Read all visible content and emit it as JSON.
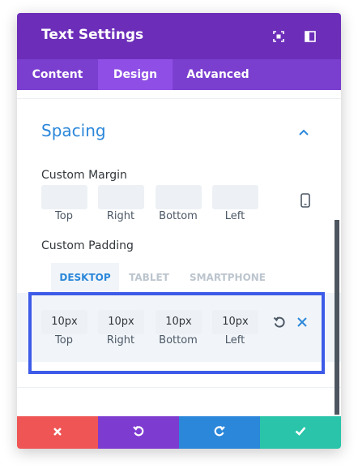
{
  "header": {
    "title": "Text Settings",
    "expand_icon": "expand-icon",
    "sidebar_icon": "split-panel-icon",
    "color": "#6c2eb9"
  },
  "tabs": [
    {
      "label": "Content",
      "active": false
    },
    {
      "label": "Design",
      "active": true
    },
    {
      "label": "Advanced",
      "active": false
    }
  ],
  "spacing": {
    "title": "Spacing",
    "margin": {
      "label": "Custom Margin",
      "fields": [
        {
          "label": "Top",
          "value": ""
        },
        {
          "label": "Right",
          "value": ""
        },
        {
          "label": "Bottom",
          "value": ""
        },
        {
          "label": "Left",
          "value": ""
        }
      ],
      "responsive_icon": "phone-icon"
    },
    "padding": {
      "label": "Custom Padding",
      "device_tabs": [
        {
          "label": "DESKTOP",
          "active": true
        },
        {
          "label": "TABLET",
          "active": false
        },
        {
          "label": "SMARTPHONE",
          "active": false
        }
      ],
      "fields": [
        {
          "label": "Top",
          "value": "10px"
        },
        {
          "label": "Right",
          "value": "10px"
        },
        {
          "label": "Bottom",
          "value": "10px"
        },
        {
          "label": "Left",
          "value": "10px"
        }
      ],
      "reset_icon": "reset-icon",
      "clear_icon": "close-icon"
    }
  },
  "footer": [
    {
      "icon": "close-icon",
      "color": "#ef5555"
    },
    {
      "icon": "undo-icon",
      "color": "#7e3bd0"
    },
    {
      "icon": "redo-icon",
      "color": "#2b87da"
    },
    {
      "icon": "check-icon",
      "color": "#29c4a9"
    }
  ],
  "colors": {
    "accent": "#2b87da",
    "highlight": "#3d5be8",
    "tab_bar": "#7b3fd0",
    "active_tab": "#8f4fe6"
  }
}
